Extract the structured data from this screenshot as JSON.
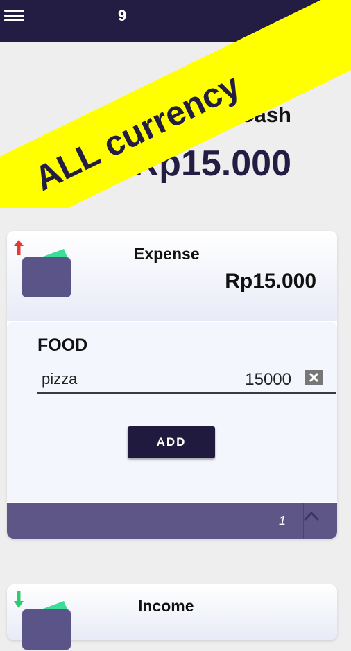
{
  "app": {
    "title": "9"
  },
  "ribbon": {
    "text": "ALL currency"
  },
  "summary": {
    "label": "Total Cash",
    "value": "-Rp15.000"
  },
  "expense": {
    "title": "Expense",
    "amount": "Rp15.000",
    "category": {
      "name": "FOOD",
      "entries": [
        {
          "name": "pizza",
          "amount": "15000"
        }
      ]
    },
    "add_label": "ADD",
    "page_count": "1"
  },
  "income": {
    "title": "Income"
  },
  "colors": {
    "primary": "#231d43",
    "ribbon": "#ffff00",
    "footer": "#5d5687",
    "expense_arrow": "#e53935",
    "income_arrow": "#2ecc71",
    "wallet": "#5b5488",
    "wallet_bill": "#3ddc97"
  },
  "icons": [
    "menu-icon",
    "arrow-up-icon",
    "wallet-icon",
    "delete-icon",
    "chevron-up-icon",
    "arrow-down-icon"
  ]
}
